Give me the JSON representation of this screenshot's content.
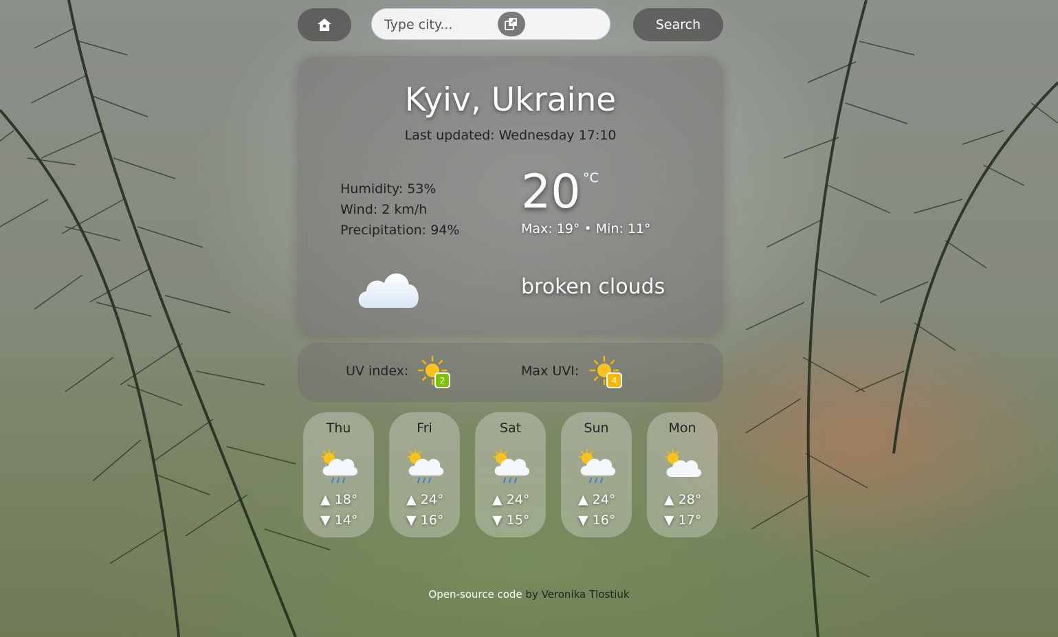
{
  "header": {
    "home_icon": "home-icon",
    "search_placeholder": "Type city...",
    "paste_icon": "paste-icon",
    "search_label": "Search"
  },
  "current": {
    "city": "Kyiv, Ukraine",
    "updated": "Last updated: Wednesday 17:10",
    "humidity": "Humidity: 53%",
    "wind": "Wind: 2 km/h",
    "precipitation": "Precipitation: 94%",
    "temp": "20",
    "unit": "°C",
    "maxmin": "Max: 19° • Min: 11°",
    "icon": "broken-clouds-icon",
    "description": "broken clouds"
  },
  "uv": {
    "label": "UV index:",
    "value": "2",
    "value_color": "#7cc400",
    "max_label": "Max UVI:",
    "max_value": "4",
    "max_color": "#f5b800"
  },
  "forecast": [
    {
      "day": "Thu",
      "icon": "sun-cloud-rain-icon",
      "hi": "▲ 18°",
      "lo": "▼ 14°"
    },
    {
      "day": "Fri",
      "icon": "sun-cloud-rain-icon",
      "hi": "▲ 24°",
      "lo": "▼ 16°"
    },
    {
      "day": "Sat",
      "icon": "sun-cloud-rain-icon",
      "hi": "▲ 24°",
      "lo": "▼ 15°"
    },
    {
      "day": "Sun",
      "icon": "sun-cloud-rain-icon",
      "hi": "▲ 24°",
      "lo": "▼ 16°"
    },
    {
      "day": "Mon",
      "icon": "sun-cloud-icon",
      "hi": "▲ 28°",
      "lo": "▼ 17°"
    }
  ],
  "footer": {
    "link_text": "Open-source code",
    "rest": " by Veronika Tlostiuk"
  }
}
